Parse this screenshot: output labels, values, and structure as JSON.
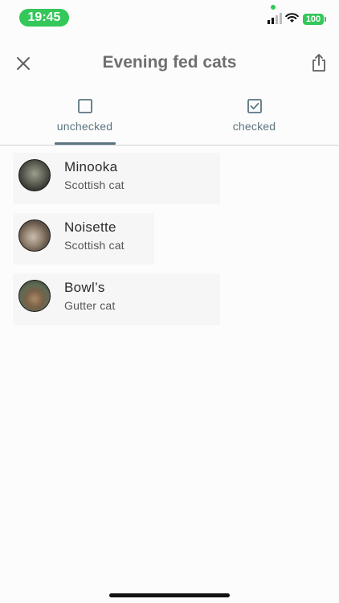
{
  "status_bar": {
    "time": "19:45",
    "battery": "100",
    "accent_color": "#34c759"
  },
  "header": {
    "title": "Evening fed cats",
    "close_icon": "close-icon",
    "share_icon": "share-icon"
  },
  "tabs": [
    {
      "label": "unchecked",
      "icon": "checkbox-empty-icon",
      "selected": true
    },
    {
      "label": "checked",
      "icon": "checkbox-checked-icon",
      "selected": false
    }
  ],
  "cats": [
    {
      "name": "Minooka",
      "breed": "Scottish cat"
    },
    {
      "name": "Noisette",
      "breed": "Scottish cat"
    },
    {
      "name": "Bowl’s",
      "breed": "Gutter cat"
    }
  ],
  "colors": {
    "tab_accent": "#5b7480",
    "title": "#6f6f6f"
  }
}
